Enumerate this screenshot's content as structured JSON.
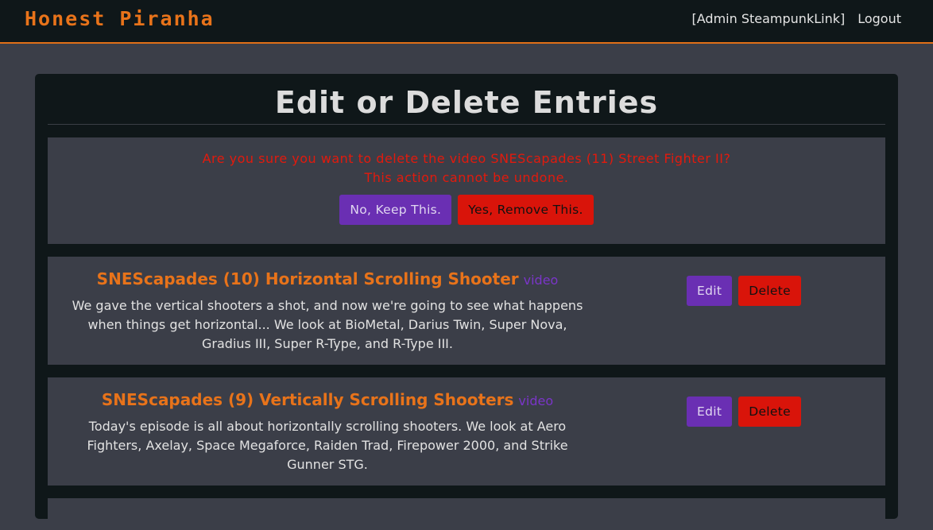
{
  "nav": {
    "brand": "Honest Piranha",
    "user": "[Admin SteampunkLink]",
    "logout": "Logout"
  },
  "page": {
    "title": "Edit or Delete Entries"
  },
  "confirm": {
    "line1": "Are you sure you want to delete the video SNEScapades (11) Street Fighter II?",
    "line2": "This action cannot be undone.",
    "keep_label": "No, Keep This.",
    "remove_label": "Yes, Remove This."
  },
  "entries": [
    {
      "title": "SNEScapades (10) Horizontal Scrolling Shooter",
      "type": "video",
      "description": "We gave the vertical shooters a shot, and now we're going to see what happens when things get horizontal... We look at BioMetal, Darius Twin, Super Nova, Gradius III, Super R-Type, and R-Type III.",
      "edit_label": "Edit",
      "delete_label": "Delete"
    },
    {
      "title": "SNEScapades (9) Vertically Scrolling Shooters",
      "type": "video",
      "description": "Today's episode is all about horizontally scrolling shooters. We look at Aero Fighters, Axelay, Space Megaforce, Raiden Trad, Firepower 2000, and Strike Gunner STG.",
      "edit_label": "Edit",
      "delete_label": "Delete"
    }
  ],
  "colors": {
    "accent": "#e8731a",
    "danger": "#d9140a",
    "purple": "#6a2fb3",
    "background": "#3b3e48",
    "panel": "#0f1719"
  }
}
